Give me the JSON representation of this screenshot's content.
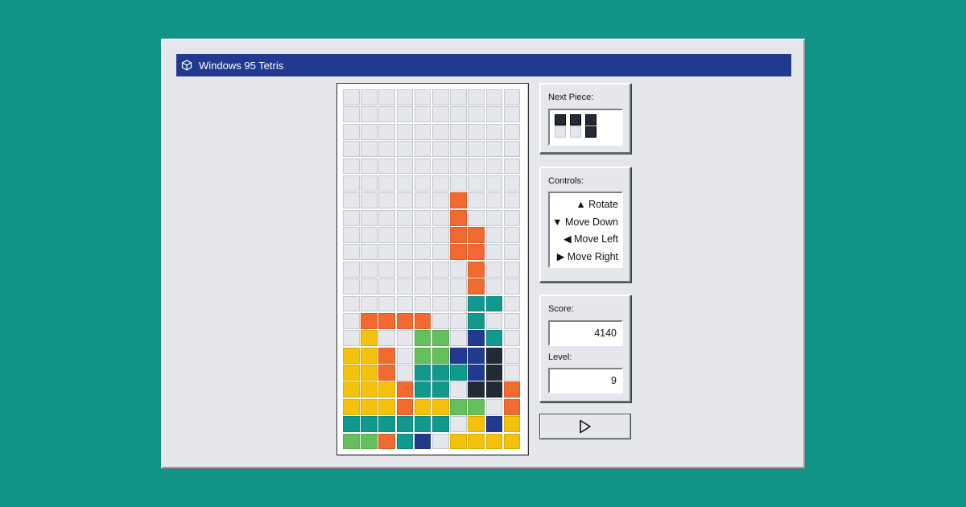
{
  "window": {
    "title": "Windows 95 Tetris"
  },
  "colors": {
    "background": "#0f9487",
    "titlebar": "#213a8f",
    "empty_cell": "#e6e7ec",
    "O": "#f4c20d",
    "S": "#63c05c",
    "I": "#f26a2f",
    "T": "#11998e",
    "J": "#213a8f",
    "L": "#222a35",
    "next_dark": "#222a35"
  },
  "board": {
    "columns": 10,
    "rows": 20,
    "legend": ". = empty, O/S/I/T/J/L = filled cell color",
    "grid": [
      "..........",
      "..........",
      "..........",
      "..........",
      "..........",
      "..........",
      "......I...",
      "......I...",
      "......II..",
      "......II..",
      ".......I..",
      ".......I..",
      ".......TT.",
      ".IIII..T..",
      ".O..SS.JT.",
      "OOI.SSJJL.",
      "OOI.TTTJL.",
      "OOOITT.LLI",
      "OOOIOOSS.I",
      "TTTTTT.OJO",
      "SSITJ.OOOO"
    ]
  },
  "next_piece": {
    "label": "Next Piece:",
    "cells": [
      [
        1,
        1,
        1
      ],
      [
        0,
        0,
        1
      ]
    ]
  },
  "controls": {
    "label": "Controls:",
    "items": [
      "▲ Rotate",
      "▼ Move Down",
      "◀ Move Left",
      "▶ Move Right"
    ]
  },
  "score": {
    "label": "Score:",
    "value": "4140"
  },
  "level": {
    "label": "Level:",
    "value": "9"
  },
  "play_button": {
    "icon": "play-icon"
  }
}
